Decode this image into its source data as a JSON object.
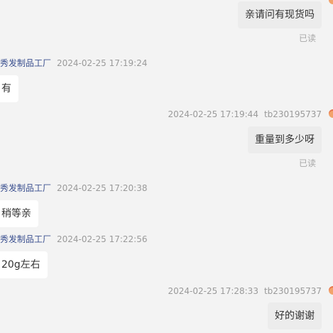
{
  "messages": [
    {
      "type": "out",
      "text": "亲请问有现货吗",
      "read": "已读"
    },
    {
      "type": "in",
      "sender": "新秀发制品工厂",
      "time": "2024-02-25 17:19:24",
      "text": "有"
    },
    {
      "type": "out",
      "time": "2024-02-25 17:19:44",
      "sender": "tb230195737",
      "text": "重量到多少呀",
      "read": "已读"
    },
    {
      "type": "in",
      "sender": "新秀发制品工厂",
      "time": "2024-02-25 17:20:38",
      "text": "稍等亲"
    },
    {
      "type": "in",
      "sender": "新秀发制品工厂",
      "time": "2024-02-25 17:22:56",
      "text": "20g左右"
    },
    {
      "type": "out",
      "time": "2024-02-25 17:28:33",
      "sender": "tb230195737",
      "text": "好的谢谢"
    }
  ],
  "colors": {
    "background": "#f3f3f3",
    "incoming_bubble": "#ffffff",
    "outgoing_bubble": "#ececec",
    "sender_name": "#3a4f8f",
    "meta_text": "#9a9a9a",
    "avatar": "#f2a36b"
  }
}
